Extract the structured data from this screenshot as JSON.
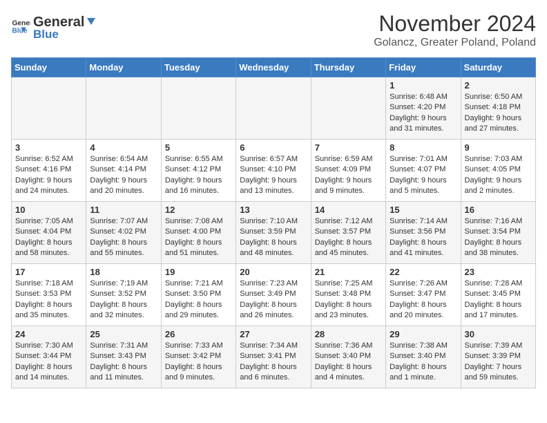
{
  "logo": {
    "general": "General",
    "blue": "Blue"
  },
  "header": {
    "month": "November 2024",
    "location": "Golancz, Greater Poland, Poland"
  },
  "days_of_week": [
    "Sunday",
    "Monday",
    "Tuesday",
    "Wednesday",
    "Thursday",
    "Friday",
    "Saturday"
  ],
  "weeks": [
    [
      {
        "day": "",
        "info": ""
      },
      {
        "day": "",
        "info": ""
      },
      {
        "day": "",
        "info": ""
      },
      {
        "day": "",
        "info": ""
      },
      {
        "day": "",
        "info": ""
      },
      {
        "day": "1",
        "info": "Sunrise: 6:48 AM\nSunset: 4:20 PM\nDaylight: 9 hours and 31 minutes."
      },
      {
        "day": "2",
        "info": "Sunrise: 6:50 AM\nSunset: 4:18 PM\nDaylight: 9 hours and 27 minutes."
      }
    ],
    [
      {
        "day": "3",
        "info": "Sunrise: 6:52 AM\nSunset: 4:16 PM\nDaylight: 9 hours and 24 minutes."
      },
      {
        "day": "4",
        "info": "Sunrise: 6:54 AM\nSunset: 4:14 PM\nDaylight: 9 hours and 20 minutes."
      },
      {
        "day": "5",
        "info": "Sunrise: 6:55 AM\nSunset: 4:12 PM\nDaylight: 9 hours and 16 minutes."
      },
      {
        "day": "6",
        "info": "Sunrise: 6:57 AM\nSunset: 4:10 PM\nDaylight: 9 hours and 13 minutes."
      },
      {
        "day": "7",
        "info": "Sunrise: 6:59 AM\nSunset: 4:09 PM\nDaylight: 9 hours and 9 minutes."
      },
      {
        "day": "8",
        "info": "Sunrise: 7:01 AM\nSunset: 4:07 PM\nDaylight: 9 hours and 5 minutes."
      },
      {
        "day": "9",
        "info": "Sunrise: 7:03 AM\nSunset: 4:05 PM\nDaylight: 9 hours and 2 minutes."
      }
    ],
    [
      {
        "day": "10",
        "info": "Sunrise: 7:05 AM\nSunset: 4:04 PM\nDaylight: 8 hours and 58 minutes."
      },
      {
        "day": "11",
        "info": "Sunrise: 7:07 AM\nSunset: 4:02 PM\nDaylight: 8 hours and 55 minutes."
      },
      {
        "day": "12",
        "info": "Sunrise: 7:08 AM\nSunset: 4:00 PM\nDaylight: 8 hours and 51 minutes."
      },
      {
        "day": "13",
        "info": "Sunrise: 7:10 AM\nSunset: 3:59 PM\nDaylight: 8 hours and 48 minutes."
      },
      {
        "day": "14",
        "info": "Sunrise: 7:12 AM\nSunset: 3:57 PM\nDaylight: 8 hours and 45 minutes."
      },
      {
        "day": "15",
        "info": "Sunrise: 7:14 AM\nSunset: 3:56 PM\nDaylight: 8 hours and 41 minutes."
      },
      {
        "day": "16",
        "info": "Sunrise: 7:16 AM\nSunset: 3:54 PM\nDaylight: 8 hours and 38 minutes."
      }
    ],
    [
      {
        "day": "17",
        "info": "Sunrise: 7:18 AM\nSunset: 3:53 PM\nDaylight: 8 hours and 35 minutes."
      },
      {
        "day": "18",
        "info": "Sunrise: 7:19 AM\nSunset: 3:52 PM\nDaylight: 8 hours and 32 minutes."
      },
      {
        "day": "19",
        "info": "Sunrise: 7:21 AM\nSunset: 3:50 PM\nDaylight: 8 hours and 29 minutes."
      },
      {
        "day": "20",
        "info": "Sunrise: 7:23 AM\nSunset: 3:49 PM\nDaylight: 8 hours and 26 minutes."
      },
      {
        "day": "21",
        "info": "Sunrise: 7:25 AM\nSunset: 3:48 PM\nDaylight: 8 hours and 23 minutes."
      },
      {
        "day": "22",
        "info": "Sunrise: 7:26 AM\nSunset: 3:47 PM\nDaylight: 8 hours and 20 minutes."
      },
      {
        "day": "23",
        "info": "Sunrise: 7:28 AM\nSunset: 3:45 PM\nDaylight: 8 hours and 17 minutes."
      }
    ],
    [
      {
        "day": "24",
        "info": "Sunrise: 7:30 AM\nSunset: 3:44 PM\nDaylight: 8 hours and 14 minutes."
      },
      {
        "day": "25",
        "info": "Sunrise: 7:31 AM\nSunset: 3:43 PM\nDaylight: 8 hours and 11 minutes."
      },
      {
        "day": "26",
        "info": "Sunrise: 7:33 AM\nSunset: 3:42 PM\nDaylight: 8 hours and 9 minutes."
      },
      {
        "day": "27",
        "info": "Sunrise: 7:34 AM\nSunset: 3:41 PM\nDaylight: 8 hours and 6 minutes."
      },
      {
        "day": "28",
        "info": "Sunrise: 7:36 AM\nSunset: 3:40 PM\nDaylight: 8 hours and 4 minutes."
      },
      {
        "day": "29",
        "info": "Sunrise: 7:38 AM\nSunset: 3:40 PM\nDaylight: 8 hours and 1 minute."
      },
      {
        "day": "30",
        "info": "Sunrise: 7:39 AM\nSunset: 3:39 PM\nDaylight: 7 hours and 59 minutes."
      }
    ]
  ]
}
